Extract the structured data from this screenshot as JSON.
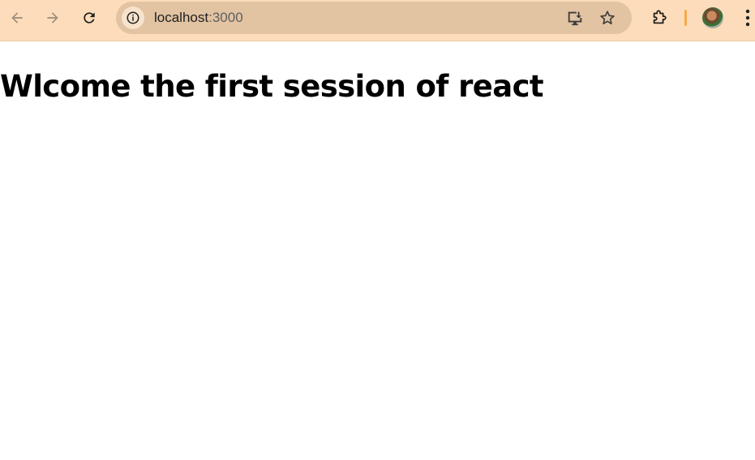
{
  "browser": {
    "address_bar": {
      "host": "localhost",
      "port": ":3000"
    },
    "icons": {
      "back": "arrow-left-icon",
      "forward": "arrow-right-icon",
      "reload": "reload-icon",
      "site_info": "info-circle-icon",
      "install": "install-app-icon",
      "bookmark": "star-icon",
      "extensions": "puzzle-piece-icon",
      "menu": "three-dots-vertical-icon"
    },
    "colors": {
      "toolbar_bg": "#fcdcba",
      "omnibox_bg": "#e2c3a2",
      "separator": "#f5a94a"
    }
  },
  "page": {
    "heading": "Wlcome the first session of react"
  }
}
